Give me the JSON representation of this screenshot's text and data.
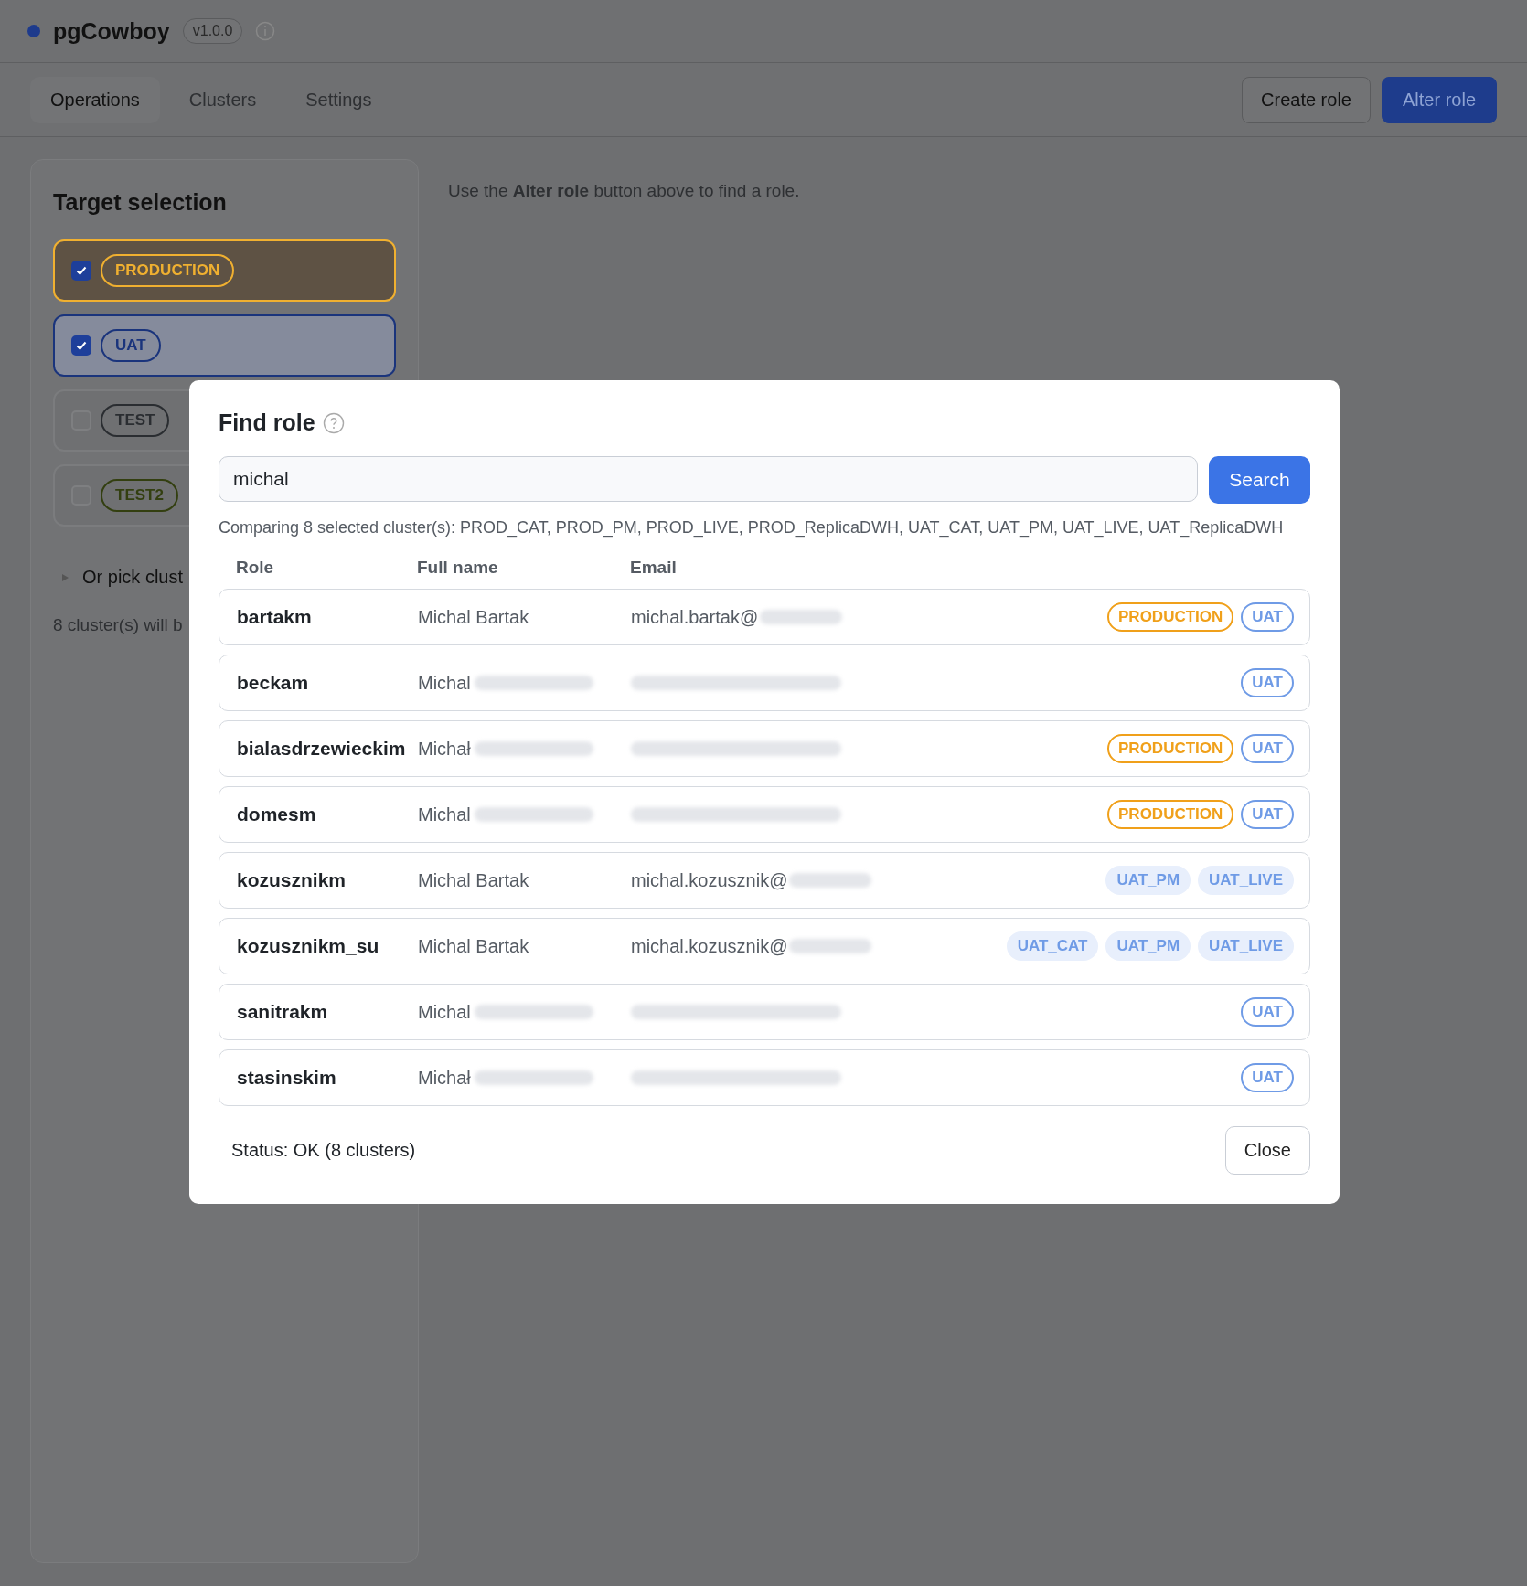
{
  "app": {
    "title": "pgCowboy",
    "version": "v1.0.0"
  },
  "tabs": [
    {
      "label": "Operations",
      "selected": true
    },
    {
      "label": "Clusters",
      "selected": false
    },
    {
      "label": "Settings",
      "selected": false
    }
  ],
  "actions": [
    {
      "label": "Create role",
      "kind": "secondary"
    },
    {
      "label": "Alter role",
      "kind": "primary"
    }
  ],
  "target_selection": {
    "title": "Target selection",
    "clusters": [
      {
        "label": "PRODUCTION",
        "checked": true,
        "color": "#f0b030"
      },
      {
        "label": "UAT",
        "checked": true,
        "color": "#1a347c"
      },
      {
        "label": "TEST",
        "checked": false,
        "color": "#2a2d31"
      },
      {
        "label": "TEST2",
        "checked": false,
        "color": "#333f10"
      }
    ],
    "picker": "Or pick clust",
    "summary": "8 cluster(s) will b"
  },
  "hint": "Use the **Alter role** button above to find a role.",
  "dialog": {
    "title": "Find role",
    "search": {
      "value": "michal"
    },
    "search_button": "Search",
    "comparing": "Comparing 8 selected cluster(s): PROD_CAT, PROD_PM, PROD_LIVE, PROD_ReplicaDWH, UAT_CAT, UAT_PM, UAT_LIVE, UAT_ReplicaDWH",
    "columns": [
      "Role",
      "Full name",
      "Email"
    ],
    "rows": [
      {
        "role": "bartakm",
        "full_name": "Michal Bartak",
        "name_redacted": false,
        "email": "michal.bartak@",
        "email_redacted": true,
        "tags": [
          {
            "label": "PRODUCTION",
            "kind": "env",
            "color": "#f0a01a"
          },
          {
            "label": "UAT",
            "kind": "env",
            "color": "#6f9be6"
          }
        ]
      },
      {
        "role": "beckam",
        "full_name": "Michal",
        "name_redacted": true,
        "email_redacted": true,
        "tags": [
          {
            "label": "UAT",
            "kind": "env",
            "color": "#6f9be6"
          }
        ]
      },
      {
        "role": "bialasdrzewieckim",
        "full_name": "Michał",
        "name_redacted": true,
        "email_redacted": true,
        "tags": [
          {
            "label": "PRODUCTION",
            "kind": "env",
            "color": "#f0a01a"
          },
          {
            "label": "UAT",
            "kind": "env",
            "color": "#6f9be6"
          }
        ]
      },
      {
        "role": "domesm",
        "full_name": "Michal",
        "name_redacted": true,
        "email_redacted": true,
        "tags": [
          {
            "label": "PRODUCTION",
            "kind": "env",
            "color": "#f0a01a"
          },
          {
            "label": "UAT",
            "kind": "env",
            "color": "#6f9be6"
          }
        ]
      },
      {
        "role": "kozusznikm",
        "full_name": "Michal Bartak",
        "name_redacted": false,
        "email": "michal.kozusznik@",
        "email_redacted": true,
        "tags": [
          {
            "label": "UAT_PM",
            "kind": "cluster",
            "color": "#6f9be6"
          },
          {
            "label": "UAT_LIVE",
            "kind": "cluster",
            "color": "#6f9be6"
          }
        ]
      },
      {
        "role": "kozusznikm_su",
        "full_name": "Michal Bartak",
        "name_redacted": false,
        "email": "michal.kozusznik@",
        "email_redacted": true,
        "tags": [
          {
            "label": "UAT_CAT",
            "kind": "cluster",
            "color": "#6f9be6"
          },
          {
            "label": "UAT_PM",
            "kind": "cluster",
            "color": "#6f9be6"
          },
          {
            "label": "UAT_LIVE",
            "kind": "cluster",
            "color": "#6f9be6"
          }
        ]
      },
      {
        "role": "sanitrakm",
        "full_name": "Michal",
        "name_redacted": true,
        "email_redacted": true,
        "tags": [
          {
            "label": "UAT",
            "kind": "env",
            "color": "#6f9be6"
          }
        ]
      },
      {
        "role": "stasinskim",
        "full_name": "Michał",
        "name_redacted": true,
        "email_redacted": true,
        "tags": [
          {
            "label": "UAT",
            "kind": "env",
            "color": "#6f9be6"
          }
        ]
      }
    ],
    "status": "Status: OK (8 clusters)",
    "close_button": "Close"
  }
}
